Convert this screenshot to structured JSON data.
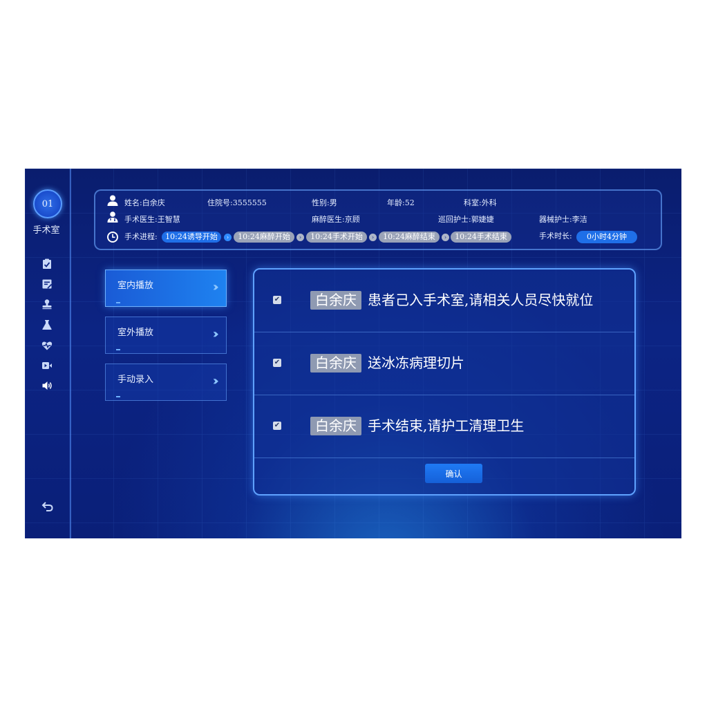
{
  "sidebar": {
    "room_number": "01",
    "room_label": "手术室",
    "icons": [
      "clipboard-check-icon",
      "form-icon",
      "stamp-icon",
      "flask-icon",
      "heart-pulse-icon",
      "video-icon",
      "speaker-icon"
    ],
    "back_icon": "back-arrow-icon"
  },
  "patient": {
    "name": "姓名:白余庆",
    "admission_no": "住院号:3555555",
    "gender": "性别:男",
    "age": "年龄:52",
    "department": "科室:外科",
    "surgeon": "手术医生:王智慧",
    "anesthetist": "麻醉医生:京顾",
    "circulating_nurse": "巡回护士:郭婕婕",
    "instrument_nurse": "器械护士:李洁",
    "progress_label": "手术进程:",
    "duration_label": "手术时长:",
    "duration_value": "0小时4分钟"
  },
  "progress_steps": [
    {
      "label": "10:24诱导开始",
      "active": true
    },
    {
      "label": "10:24麻醉开始",
      "active": false
    },
    {
      "label": "10:24手术开始",
      "active": false
    },
    {
      "label": "10:24麻醉结束",
      "active": false
    },
    {
      "label": "10:24手术结束",
      "active": false
    }
  ],
  "menu": {
    "indoor": "室内播放",
    "outdoor": "室外播放",
    "manual": "手动录入",
    "arrow_glyph": "›››"
  },
  "messages": [
    {
      "name": "白余庆",
      "text": "患者己入手术室,请相关人员尽快就位",
      "checked": true
    },
    {
      "name": "白余庆",
      "text": "送冰冻病理切片",
      "checked": true
    },
    {
      "name": "白余庆",
      "text": "手术结束,请护工清理卫生",
      "checked": true
    }
  ],
  "confirm_label": "确认",
  "colors": {
    "accent": "#1f6fe8",
    "background": "#0c2484",
    "inactive_pill": "#9aa3b8"
  }
}
